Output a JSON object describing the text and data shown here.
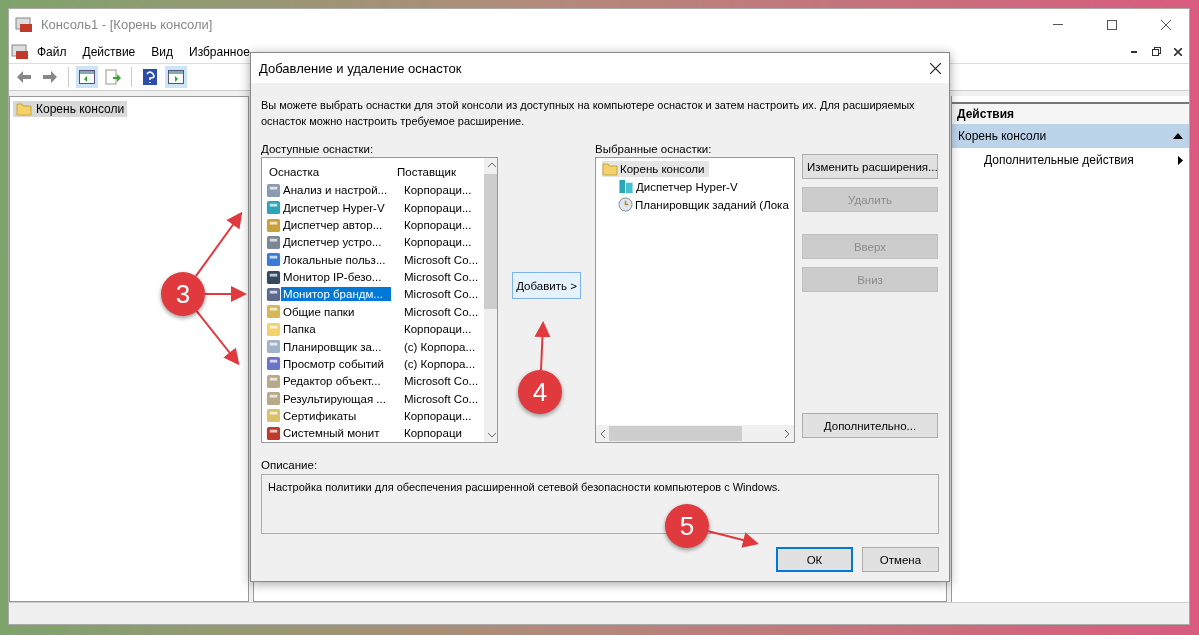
{
  "window": {
    "title": "Консоль1 - [Корень консоли]"
  },
  "menu": [
    "Файл",
    "Действие",
    "Вид",
    "Избранное"
  ],
  "console_tree": [
    {
      "label": "Корень консоли",
      "selected": true
    }
  ],
  "actions": {
    "title": "Действия",
    "section": "Корень консоли",
    "items": [
      "Дополнительные действия"
    ]
  },
  "dialog": {
    "title": "Добавление и удаление оснасток",
    "intro": "Вы можете выбрать оснастки для этой консоли из доступных на компьютере оснасток и затем настроить их. Для расширяемых оснасток можно настроить требуемое расширение.",
    "available": {
      "label": "Доступные оснастки:",
      "columns": [
        "Оснастка",
        "Поставщик"
      ],
      "rows": [
        {
          "name": "Анализ и настрой...",
          "vendor": "Корпораци...",
          "selected": false
        },
        {
          "name": "Диспетчер Hyper-V",
          "vendor": "Корпораци...",
          "selected": false
        },
        {
          "name": "Диспетчер автор...",
          "vendor": "Корпораци...",
          "selected": false
        },
        {
          "name": "Диспетчер устро...",
          "vendor": "Корпораци...",
          "selected": false
        },
        {
          "name": "Локальные польз...",
          "vendor": "Microsoft Co...",
          "selected": false
        },
        {
          "name": "Монитор IP-безо...",
          "vendor": "Microsoft Co...",
          "selected": false
        },
        {
          "name": "Монитор брандм...",
          "vendor": "Microsoft Co...",
          "selected": true
        },
        {
          "name": "Общие папки",
          "vendor": "Microsoft Co...",
          "selected": false
        },
        {
          "name": "Папка",
          "vendor": "Корпораци...",
          "selected": false
        },
        {
          "name": "Планировщик за...",
          "vendor": "(c) Корпора...",
          "selected": false
        },
        {
          "name": "Просмотр событий",
          "vendor": "(c) Корпора...",
          "selected": false
        },
        {
          "name": "Редактор объект...",
          "vendor": "Microsoft Co...",
          "selected": false
        },
        {
          "name": "Результирующая ...",
          "vendor": "Microsoft Co...",
          "selected": false
        },
        {
          "name": "Сертификаты",
          "vendor": "Корпораци...",
          "selected": false
        },
        {
          "name": "Системный монит",
          "vendor": "Корпораци",
          "selected": false
        }
      ]
    },
    "add_button": "Добавить >",
    "chosen": {
      "label": "Выбранные оснастки:",
      "tree": [
        {
          "label": "Корень консоли",
          "selected": true,
          "children": [
            {
              "label": "Диспетчер Hyper-V",
              "selected": false
            },
            {
              "label": "Планировщик заданий (Лока",
              "selected": false
            }
          ]
        }
      ]
    },
    "side_buttons": [
      {
        "label": "Изменить расширения...",
        "disabled": false
      },
      {
        "label": "Удалить",
        "disabled": true
      },
      {
        "label": "Вверх",
        "disabled": true
      },
      {
        "label": "Вниз",
        "disabled": true
      },
      {
        "label": "Дополнительно...",
        "disabled": false
      }
    ],
    "description": {
      "label": "Описание:",
      "text": "Настройка политики для обеспечения расширенной сетевой безопасности компьютеров с Windows."
    },
    "buttons": [
      {
        "label": "ОК",
        "default": true
      },
      {
        "label": "Отмена",
        "default": false
      }
    ]
  },
  "annotations": [
    "3",
    "4",
    "5"
  ]
}
